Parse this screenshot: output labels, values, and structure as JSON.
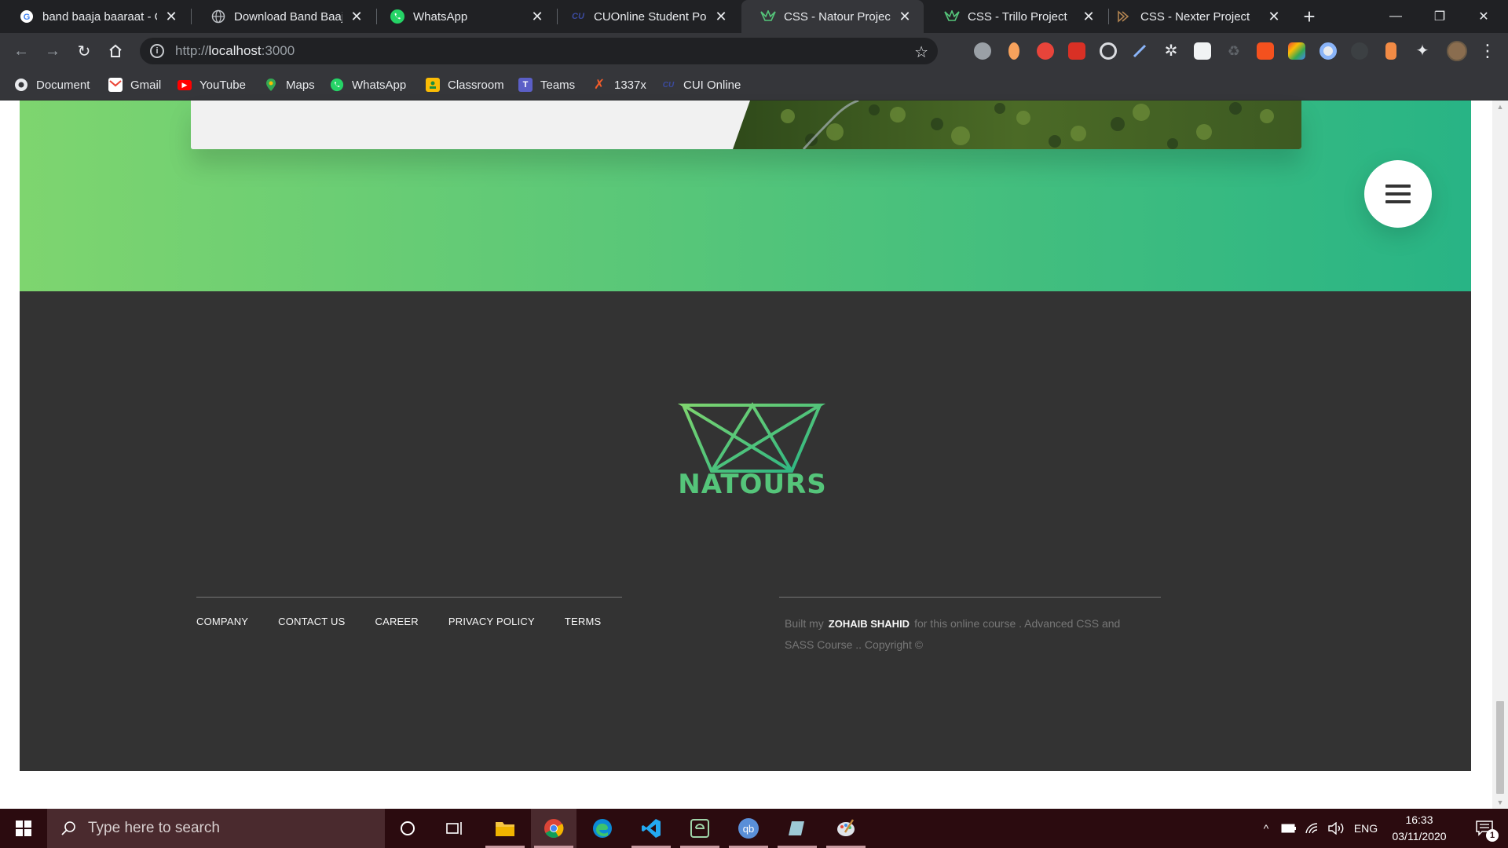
{
  "browser": {
    "tabs": [
      {
        "title": "band baaja baaraat - G",
        "icon": "google-icon"
      },
      {
        "title": "Download Band Baaja",
        "icon": "globe-icon"
      },
      {
        "title": "WhatsApp",
        "icon": "whatsapp-icon"
      },
      {
        "title": "CUOnline Student Port",
        "icon": "cu-icon"
      },
      {
        "title": "CSS - Natour Project",
        "icon": "natours-icon",
        "active": true
      },
      {
        "title": "CSS - Trillo Project",
        "icon": "natours-icon"
      },
      {
        "title": "CSS - Nexter Project",
        "icon": "nexter-icon"
      }
    ],
    "new_tab_label": "+",
    "window_controls": {
      "minimize": "—",
      "restore": "❐",
      "close": "✕"
    },
    "url": {
      "scheme": "http://",
      "host": "localhost",
      "port": ":3000"
    },
    "bookmarks": [
      {
        "label": "Document",
        "icon": "chrome-icon"
      },
      {
        "label": "Gmail",
        "icon": "gmail-icon"
      },
      {
        "label": "YouTube",
        "icon": "youtube-icon"
      },
      {
        "label": "Maps",
        "icon": "maps-icon"
      },
      {
        "label": "WhatsApp",
        "icon": "whatsapp-icon"
      },
      {
        "label": "Classroom",
        "icon": "classroom-icon"
      },
      {
        "label": "Teams",
        "icon": "teams-icon"
      },
      {
        "label": "1337x",
        "icon": "x-icon"
      },
      {
        "label": "CUI Online",
        "icon": "cu-icon"
      }
    ]
  },
  "page": {
    "logo_text": "NATOURS",
    "footer_links": [
      "Company",
      "Contact us",
      "Career",
      "Privacy policy",
      "Terms"
    ],
    "credit": {
      "prefix": "Built my",
      "name": "ZOHAIB SHAHID",
      "suffix": "for this online course . Advanced CSS and SASS Course .. Copyright ©"
    },
    "colors": {
      "primary_light": "#7ed56f",
      "primary_dark": "#28b485",
      "footer_bg": "#333333"
    }
  },
  "taskbar": {
    "search_placeholder": "Type here to search",
    "tray_language": "ENG",
    "clock_time": "16:33",
    "clock_date": "03/11/2020",
    "notification_count": "1"
  }
}
